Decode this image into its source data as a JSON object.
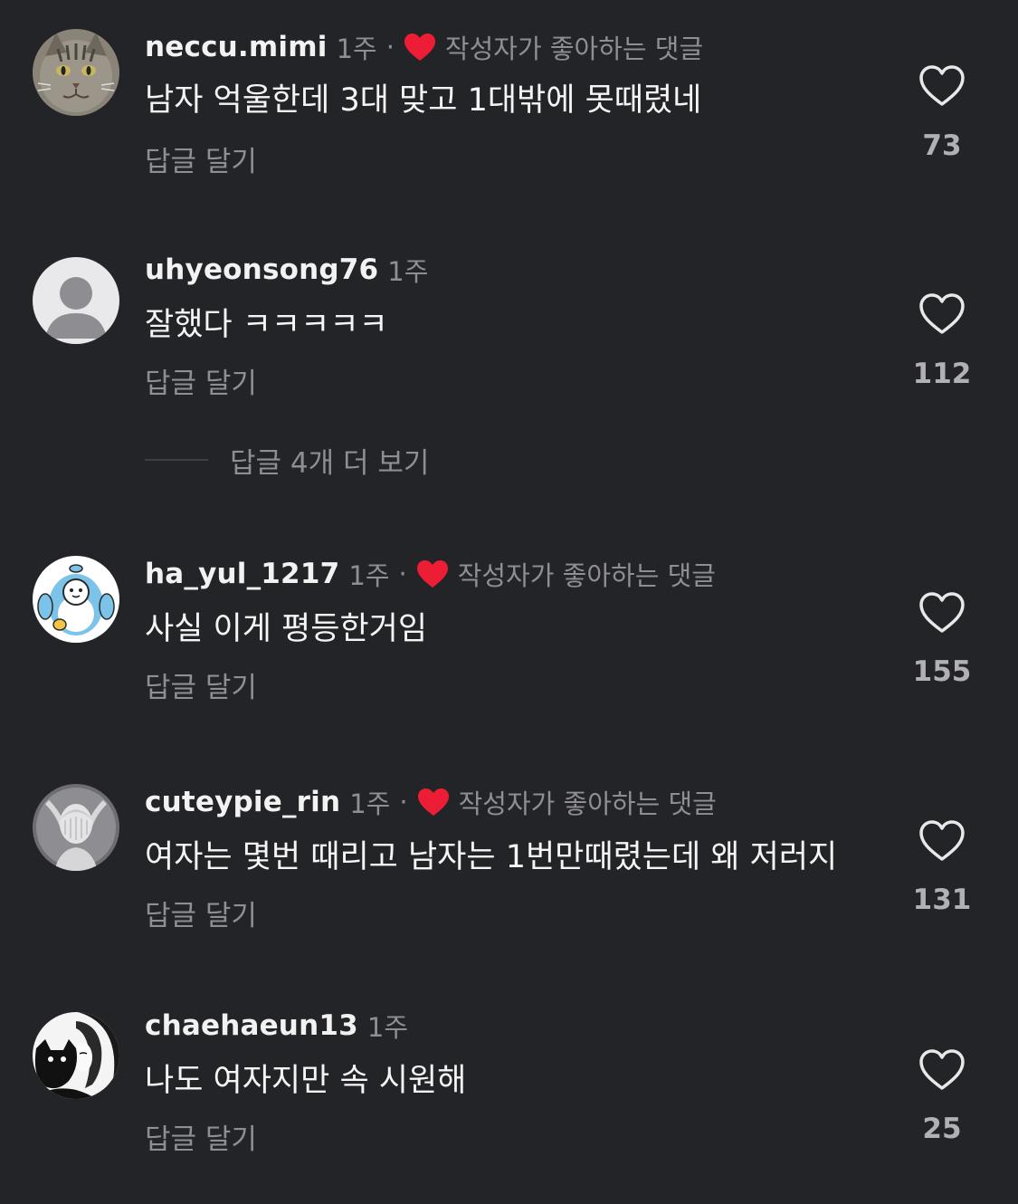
{
  "comments": [
    {
      "username": "neccu.mimi",
      "time": "1주",
      "creator_liked": true,
      "creator_liked_label": "작성자가 좋아하는 댓글",
      "text": "남자 억울한데 3대 맞고 1대밖에 못때렸네",
      "reply_label": "답글 달기",
      "likes": "73",
      "avatar": "cat-photo"
    },
    {
      "username": "uhyeonsong76",
      "time": "1주",
      "creator_liked": false,
      "creator_liked_label": "",
      "text": "잘했다 ㅋㅋㅋㅋㅋ",
      "reply_label": "답글 달기",
      "likes": "112",
      "avatar": "default-person"
    },
    {
      "username": "ha_yul_1217",
      "time": "1주",
      "creator_liked": true,
      "creator_liked_label": "작성자가 좋아하는 댓글",
      "text": "사실 이게 평등한거임",
      "reply_label": "답글 달기",
      "likes": "155",
      "avatar": "blue-penguin-cartoon"
    },
    {
      "username": "cuteypie_rin",
      "time": "1주",
      "creator_liked": true,
      "creator_liked_label": "작성자가 좋아하는 댓글",
      "text": "여자는 몇번 때리고 남자는 1번만때렸는데 왜 저러지",
      "reply_label": "답글 달기",
      "likes": "131",
      "avatar": "white-statue"
    },
    {
      "username": "chaehaeun13",
      "time": "1주",
      "creator_liked": false,
      "creator_liked_label": "",
      "text": "나도 여자지만 속 시원해",
      "reply_label": "답글 달기",
      "likes": "25",
      "avatar": "manga-girl-with-cat"
    }
  ],
  "more_replies_label": "답글 4개 더 보기",
  "colors": {
    "background": "#232428",
    "text": "#f5f5f5",
    "muted": "#8e8e93",
    "heart_red": "#ee1d36"
  }
}
